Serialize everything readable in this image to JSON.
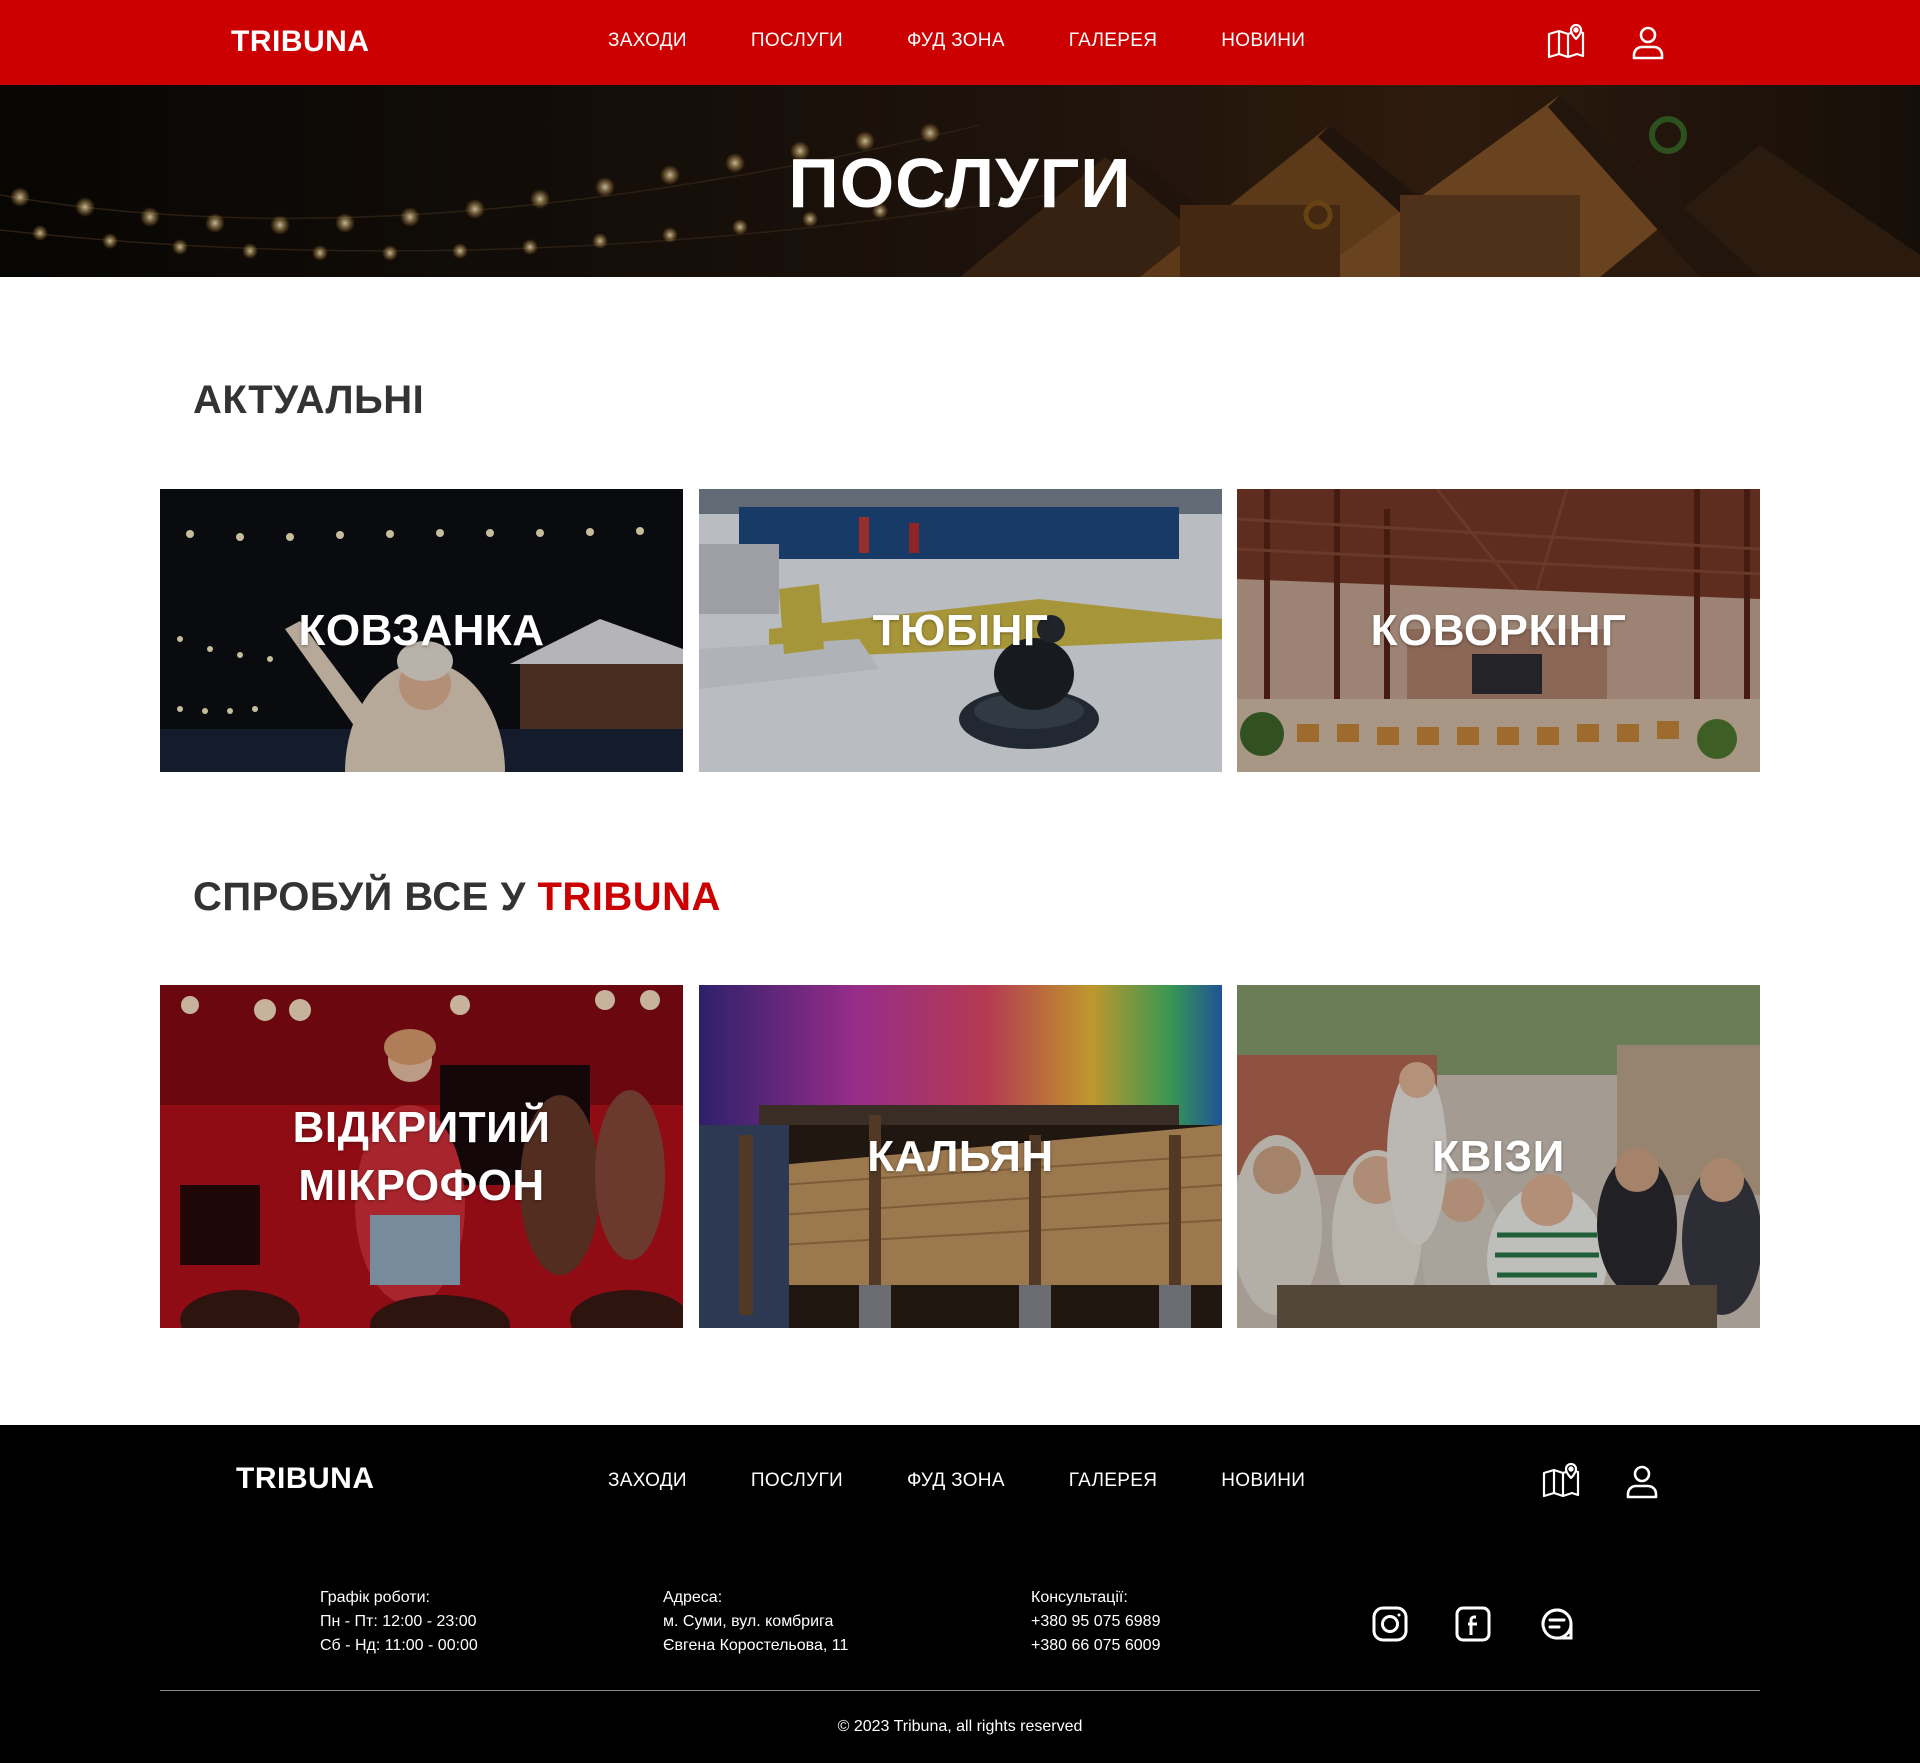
{
  "brand": {
    "name": "TRIBUNA",
    "accent_color": "#cc0000",
    "footer_bg": "#000000"
  },
  "nav": {
    "items": [
      {
        "label": "ЗАХОДИ"
      },
      {
        "label": "ПОСЛУГИ"
      },
      {
        "label": "ФУД ЗОНА"
      },
      {
        "label": "ГАЛЕРЕЯ"
      },
      {
        "label": "НОВИНИ"
      }
    ],
    "icons": [
      "map-icon",
      "user-icon"
    ]
  },
  "hero": {
    "title": "ПОСЛУГИ"
  },
  "sections": {
    "current": {
      "title": "АКТУАЛЬНІ",
      "cards": [
        {
          "label": "КОВЗАНКА",
          "image": "ice-rink-photo"
        },
        {
          "label": "ТЮБІНГ",
          "image": "tubing-photo"
        },
        {
          "label": "КОВОРКІНГ",
          "image": "coworking-photo"
        }
      ]
    },
    "try_all": {
      "title_prefix": "СПРОБУЙ ВСЕ У",
      "title_accent": "TRIBUNA",
      "cards": [
        {
          "label": "ВІДКРИТИЙ МІКРОФОН",
          "image": "open-mic-photo"
        },
        {
          "label": "КАЛЬЯН",
          "image": "hookah-photo"
        },
        {
          "label": "КВІЗИ",
          "image": "quiz-photo"
        }
      ]
    }
  },
  "footer": {
    "schedule": {
      "title": "Графік роботи:",
      "line1": "Пн - Пт: 12:00 - 23:00",
      "line2": "Сб - Нд: 11:00 - 00:00"
    },
    "address": {
      "title": "Адреса:",
      "line1": "м. Суми, вул. комбрига",
      "line2": "Євгена Коростельова, 11"
    },
    "contacts": {
      "title": "Консультації:",
      "phone1": "+380 95 075 6989",
      "phone2": "+380 66 075 6009"
    },
    "social": [
      "instagram-icon",
      "facebook-icon",
      "chat-icon"
    ],
    "copyright": "© 2023 Tribuna, all rights reserved"
  }
}
